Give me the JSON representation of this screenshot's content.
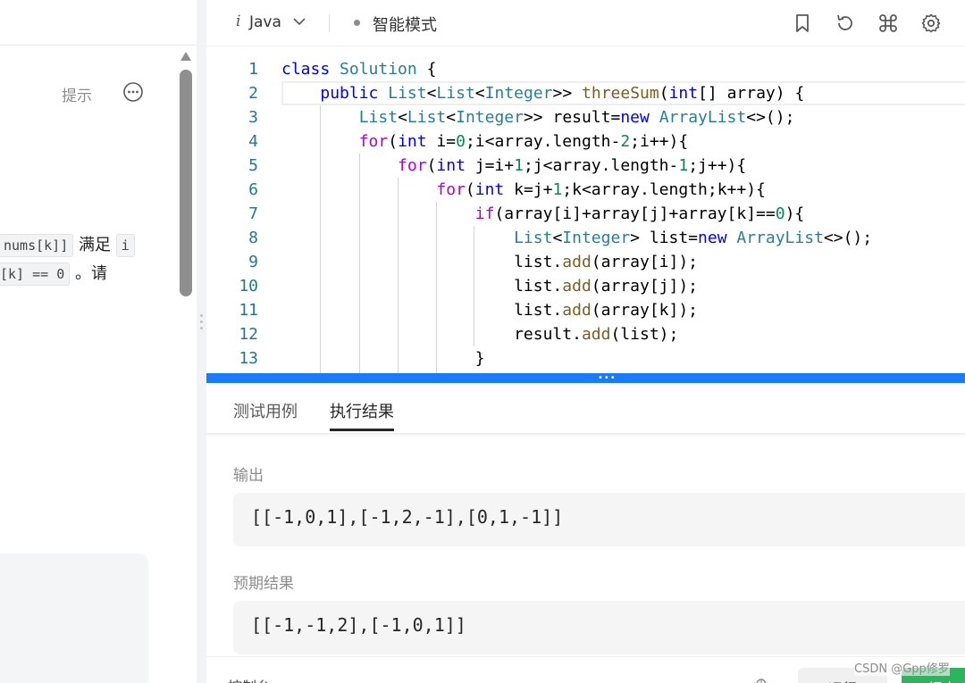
{
  "left_panel": {
    "hint_label": "提示",
    "desc_line1": {
      "chip1": "nums[k]]",
      "text": " 满足 ",
      "chip2": "i"
    },
    "desc_line2": {
      "chip1": "[k] == 0",
      "text": " 。请"
    }
  },
  "editor": {
    "language_icon": "i",
    "language": "Java",
    "mode": "智能模式",
    "toolbar_icons": [
      "bookmark-icon",
      "reset-icon",
      "command-icon",
      "gear-icon"
    ],
    "lines": [
      {
        "n": "1",
        "tokens": [
          [
            "kw2",
            "class"
          ],
          [
            "pl",
            " "
          ],
          [
            "ty",
            "Solution"
          ],
          [
            "pl",
            " {"
          ]
        ]
      },
      {
        "n": "2",
        "tokens": [
          [
            "pl",
            "    "
          ],
          [
            "kw2",
            "public"
          ],
          [
            "pl",
            " "
          ],
          [
            "ty",
            "List"
          ],
          [
            "pl",
            "<"
          ],
          [
            "ty",
            "List"
          ],
          [
            "pl",
            "<"
          ],
          [
            "ty",
            "Integer"
          ],
          [
            "pl",
            ">> "
          ],
          [
            "fn",
            "threeSum"
          ],
          [
            "pl",
            "("
          ],
          [
            "kw2",
            "int"
          ],
          [
            "pl",
            "[] array) {"
          ]
        ]
      },
      {
        "n": "3",
        "tokens": [
          [
            "pl",
            "        "
          ],
          [
            "ty",
            "List"
          ],
          [
            "pl",
            "<"
          ],
          [
            "ty",
            "List"
          ],
          [
            "pl",
            "<"
          ],
          [
            "ty",
            "Integer"
          ],
          [
            "pl",
            ">> result="
          ],
          [
            "kw2",
            "new"
          ],
          [
            "pl",
            " "
          ],
          [
            "ty",
            "ArrayList"
          ],
          [
            "pl",
            "<>();"
          ]
        ]
      },
      {
        "n": "4",
        "tokens": [
          [
            "pl",
            "        "
          ],
          [
            "kw",
            "for"
          ],
          [
            "pl",
            "("
          ],
          [
            "kw2",
            "int"
          ],
          [
            "pl",
            " i="
          ],
          [
            "nm",
            "0"
          ],
          [
            "pl",
            ";i<array.length-"
          ],
          [
            "nm",
            "2"
          ],
          [
            "pl",
            ";i++){"
          ]
        ]
      },
      {
        "n": "5",
        "tokens": [
          [
            "pl",
            "            "
          ],
          [
            "kw",
            "for"
          ],
          [
            "pl",
            "("
          ],
          [
            "kw2",
            "int"
          ],
          [
            "pl",
            " j=i+"
          ],
          [
            "nm",
            "1"
          ],
          [
            "pl",
            ";j<array.length-"
          ],
          [
            "nm",
            "1"
          ],
          [
            "pl",
            ";j++){"
          ]
        ]
      },
      {
        "n": "6",
        "tokens": [
          [
            "pl",
            "                "
          ],
          [
            "kw",
            "for"
          ],
          [
            "pl",
            "("
          ],
          [
            "kw2",
            "int"
          ],
          [
            "pl",
            " k=j+"
          ],
          [
            "nm",
            "1"
          ],
          [
            "pl",
            ";k<array.length;k++){"
          ]
        ]
      },
      {
        "n": "7",
        "tokens": [
          [
            "pl",
            "                    "
          ],
          [
            "kw",
            "if"
          ],
          [
            "pl",
            "(array[i]+array[j]+array[k]=="
          ],
          [
            "nm",
            "0"
          ],
          [
            "pl",
            "){"
          ]
        ]
      },
      {
        "n": "8",
        "tokens": [
          [
            "pl",
            "                        "
          ],
          [
            "ty",
            "List"
          ],
          [
            "pl",
            "<"
          ],
          [
            "ty",
            "Integer"
          ],
          [
            "pl",
            "> list="
          ],
          [
            "kw2",
            "new"
          ],
          [
            "pl",
            " "
          ],
          [
            "ty",
            "ArrayList"
          ],
          [
            "pl",
            "<>();"
          ]
        ]
      },
      {
        "n": "9",
        "tokens": [
          [
            "pl",
            "                        list."
          ],
          [
            "fn",
            "add"
          ],
          [
            "pl",
            "(array[i]);"
          ]
        ]
      },
      {
        "n": "10",
        "tokens": [
          [
            "pl",
            "                        list."
          ],
          [
            "fn",
            "add"
          ],
          [
            "pl",
            "(array[j]);"
          ]
        ]
      },
      {
        "n": "11",
        "tokens": [
          [
            "pl",
            "                        list."
          ],
          [
            "fn",
            "add"
          ],
          [
            "pl",
            "(array[k]);"
          ]
        ]
      },
      {
        "n": "12",
        "tokens": [
          [
            "pl",
            "                        result."
          ],
          [
            "fn",
            "add"
          ],
          [
            "pl",
            "(list);"
          ]
        ]
      },
      {
        "n": "13",
        "tokens": [
          [
            "pl",
            "                    }"
          ]
        ]
      }
    ]
  },
  "results": {
    "tabs": [
      "测试用例",
      "执行结果"
    ],
    "active_tab": "执行结果",
    "output_label": "输出",
    "output_value": "[[-1,0,1],[-1,2,-1],[0,1,-1]]",
    "expected_label": "预期结果",
    "expected_value": "[[-1,-1,2],[-1,0,1]]"
  },
  "bottom": {
    "console_label": "控制台",
    "run_label": "运行",
    "submit_label": "提交"
  },
  "watermark": "CSDN @Gpp修罗",
  "colors": {
    "accent_blue": "#1a7af8",
    "submit_green": "#2db55d"
  }
}
